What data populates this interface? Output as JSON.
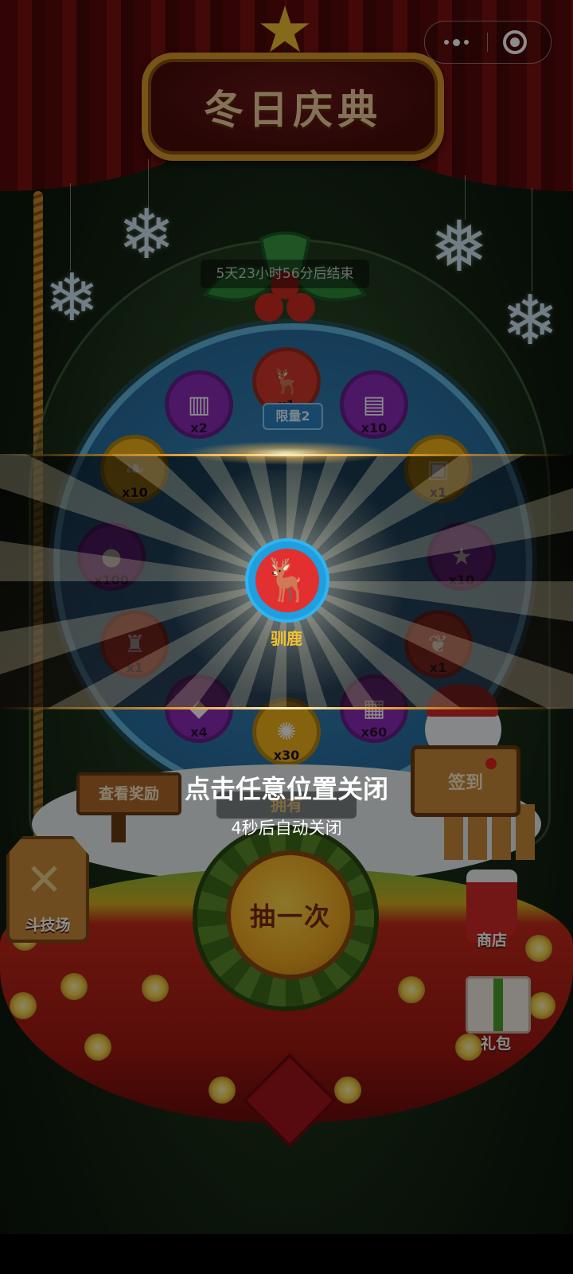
{
  "header": {
    "title": "冬日庆典",
    "menu_more_icon": "more-dots-icon",
    "menu_close_icon": "target-close-icon"
  },
  "event": {
    "countdown": "5天23小时56分后结束",
    "limit_tag": "限量2"
  },
  "wheel": {
    "slots": [
      {
        "qty": "x1",
        "icon": "deer-icon",
        "color": "#d23a2a"
      },
      {
        "qty": "x10",
        "icon": "ticket-icon",
        "color": "#8a2bb8"
      },
      {
        "qty": "x1",
        "icon": "card-icon",
        "color": "#f1b21a"
      },
      {
        "qty": "x10",
        "icon": "star-icon",
        "color": "#8a2bb8"
      },
      {
        "qty": "x1",
        "icon": "leaf-icon",
        "color": "#d23a2a"
      },
      {
        "qty": "x60",
        "icon": "chest-icon",
        "color": "#8a2bb8"
      },
      {
        "qty": "x30",
        "icon": "swirl-icon",
        "color": "#f1b21a"
      },
      {
        "qty": "x4",
        "icon": "gem-icon",
        "color": "#8a2bb8"
      },
      {
        "qty": "x1",
        "icon": "hero-icon",
        "color": "#d23a2a"
      },
      {
        "qty": "x100",
        "icon": "coin-icon",
        "color": "#8a2bb8"
      },
      {
        "qty": "x10",
        "icon": "feather-icon",
        "color": "#f1b21a"
      },
      {
        "qty": "x2",
        "icon": "book-icon",
        "color": "#8a2bb8"
      }
    ]
  },
  "reward": {
    "name": "驯鹿",
    "icon": "reindeer-avatar-icon"
  },
  "buttons": {
    "view_rewards": "查看奖励",
    "owned": "拥有",
    "draw_once": "抽一次",
    "sign_in": "签到",
    "arena": "斗技场",
    "shop": "商店",
    "gift_pack": "礼包"
  },
  "overlay": {
    "tap_to_close": "点击任意位置关闭",
    "auto_close": "4秒后自动关闭"
  },
  "colors": {
    "accent_gold": "#f2c233",
    "curtain_red": "#7a1212",
    "wheel_blue": "#2a74a8"
  }
}
